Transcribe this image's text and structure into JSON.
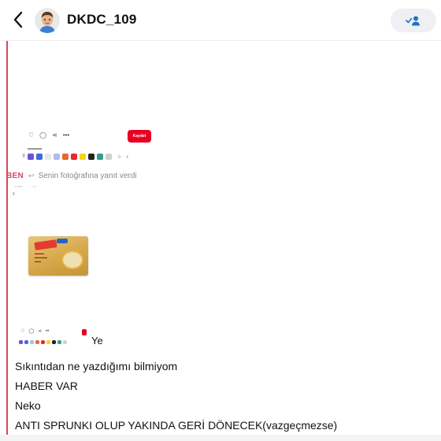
{
  "header": {
    "title": "DKDC_109",
    "back_icon": "chevron-left-icon",
    "avatar_icon": "bitmoji-avatar",
    "friend_icon": "friend-check-icon"
  },
  "colors": {
    "accent": "#d9475e",
    "pin_red": "#e60023",
    "header_btn_bg": "#eef0f3"
  },
  "embedded_top": {
    "save_button": "Kaydet",
    "icons": [
      "heart-icon",
      "comment-icon",
      "share-icon",
      "more-icon"
    ]
  },
  "reply": {
    "sender": "BEN",
    "icon": "reply-arrow-icon",
    "text": "Senin fotoğrafına yanıt verdi"
  },
  "embedded_bottom": {
    "icons": [
      "heart-icon",
      "comment-icon",
      "share-icon",
      "more-icon"
    ],
    "product_icon": "noodle-package-image"
  },
  "messages": [
    "Ye",
    "Sıkıntıdan ne yazdığımı bilmiyom",
    "HABER VAR",
    "Neko",
    "ANTI SPRUNKI OLUP YAKINDA GERİ DÖNECEK(vazgeçmezse)"
  ]
}
